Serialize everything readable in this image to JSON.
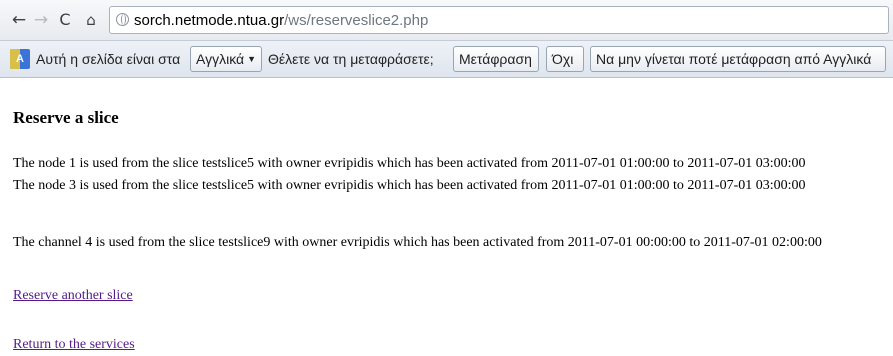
{
  "browser": {
    "back_icon": "←",
    "forward_icon": "→",
    "reload_icon": "C",
    "home_icon": "⌂",
    "url_host": "sorch.netmode.ntua.gr",
    "url_path": "/ws/reserveslice2.php"
  },
  "infobar": {
    "prompt_prefix": "Αυτή η σελίδα είναι στα",
    "language": "Αγγλικά",
    "question": "Θέλετε να τη μεταφράσετε;",
    "translate_button": "Μετάφραση",
    "no_button": "Όχι",
    "never_button": "Να μην γίνεται ποτέ μετάφραση από Αγγλικά"
  },
  "page": {
    "heading": "Reserve a slice",
    "nodes": [
      "The node 1 is used from the slice testslice5 with owner evripidis which has been activated from 2011-07-01 01:00:00 to 2011-07-01 03:00:00",
      "The node 3 is used from the slice testslice5 with owner evripidis which has been activated from 2011-07-01 01:00:00 to 2011-07-01 03:00:00"
    ],
    "channel": "The channel 4 is used from the slice testslice9 with owner evripidis which has been activated from 2011-07-01 00:00:00 to 2011-07-01 02:00:00",
    "reserve_link": "Reserve another slice",
    "return_link": "Return to the services"
  },
  "colors": {
    "visited_link": "#551a8b",
    "infobar_bg": "#e6ebf2"
  }
}
